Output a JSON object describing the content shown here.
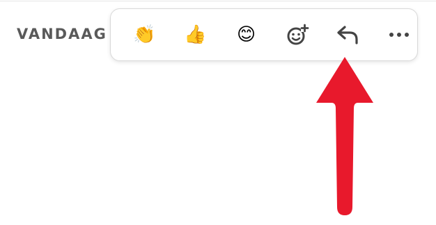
{
  "header": {
    "date_label": "VANDAAG"
  },
  "toolbar": {
    "actions": [
      {
        "name": "clap-reaction",
        "icon": "clapping-hands-icon",
        "glyph": "👏"
      },
      {
        "name": "thumbs-up-reaction",
        "icon": "thumbs-up-icon",
        "glyph": "👍"
      },
      {
        "name": "smile-reaction",
        "icon": "smiling-face-icon",
        "glyph": "😊"
      },
      {
        "name": "add-reaction",
        "icon": "add-emoji-icon"
      },
      {
        "name": "reply",
        "icon": "reply-arrow-icon"
      },
      {
        "name": "more-options",
        "icon": "more-horizontal-icon"
      }
    ]
  },
  "annotation": {
    "icon": "red-arrow-icon",
    "color": "#e8192c"
  },
  "colors": {
    "emoji_yellow": "#f5b51b",
    "icon_gray": "#444444"
  }
}
